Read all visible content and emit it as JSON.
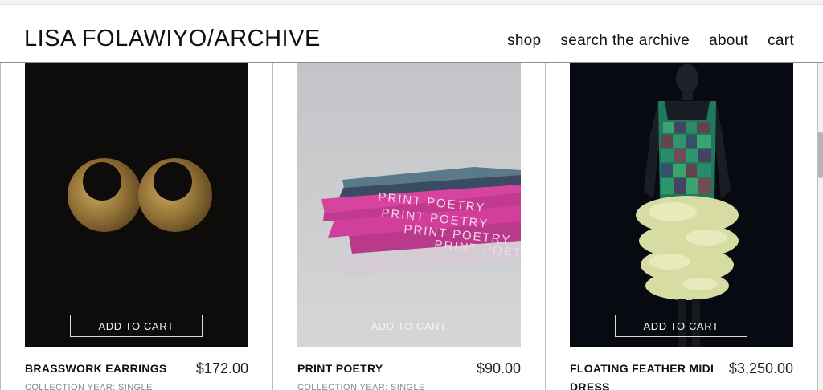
{
  "header": {
    "logo": "LISA FOLAWIYO/ARCHIVE",
    "nav": [
      "shop",
      "search the archive",
      "about",
      "cart"
    ]
  },
  "products": [
    {
      "name": "BRASSWORK EARRINGS",
      "price": "$172.00",
      "meta": "COLLECTION YEAR: SINGLE",
      "button": "ADD TO CART",
      "image": "brass-earrings-image"
    },
    {
      "name": "PRINT POETRY",
      "price": "$90.00",
      "meta": "COLLECTION YEAR: SINGLE",
      "button": "ADD TO CART",
      "image": "print-poetry-books-image",
      "book_text": "PRINT POETRY"
    },
    {
      "name": "FLOATING FEATHER MIDI DRESS",
      "price": "$3,250.00",
      "meta": "",
      "button": "ADD TO CART",
      "image": "feather-dress-image"
    }
  ],
  "colors": {
    "dark_bg": "#0b0b0b",
    "book_pink": "#d63f9c",
    "brass": "#9b7b3b",
    "grey_bg": "#c9cacc"
  }
}
